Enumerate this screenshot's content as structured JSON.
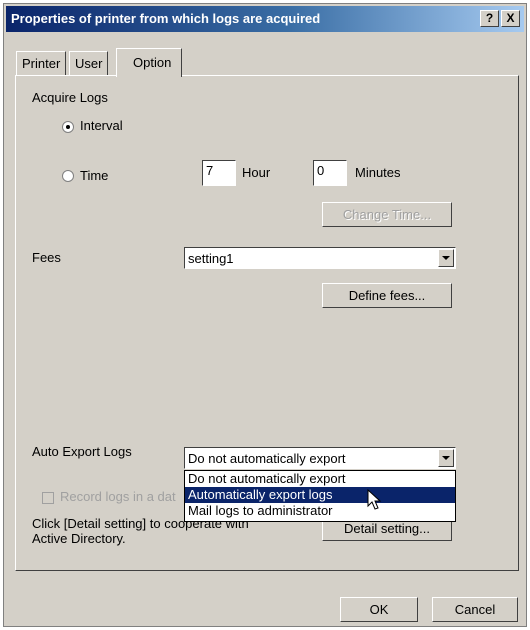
{
  "window": {
    "title": "Properties of printer from which logs are acquired",
    "help_label": "?",
    "close_label": "X"
  },
  "tabs": [
    {
      "label": "Printer"
    },
    {
      "label": "User"
    },
    {
      "label": "Option"
    }
  ],
  "acquire": {
    "group_label": "Acquire Logs",
    "interval_label": "Interval",
    "time_label": "Time",
    "hour_value": "7",
    "hour_label": "Hour",
    "minutes_value": "0",
    "minutes_label": "Minutes",
    "change_time_label": "Change Time..."
  },
  "fees": {
    "label": "Fees",
    "selected": "setting1",
    "define_label": "Define fees..."
  },
  "export": {
    "label": "Auto Export Logs",
    "selected": "Do not automatically export",
    "options": [
      "Do not automatically export",
      "Automatically export logs",
      "Mail logs to administrator"
    ],
    "record_label": "Record logs in a dat",
    "ad_text_1": "Click [Detail setting] to cooperate with",
    "ad_text_2": "Active Directory.",
    "detail_label": "Detail setting..."
  },
  "footer": {
    "ok_label": "OK",
    "cancel_label": "Cancel"
  }
}
